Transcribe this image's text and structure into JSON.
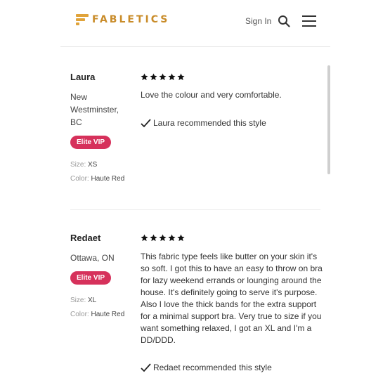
{
  "header": {
    "logo_text": "FABLETICS",
    "signin_label": "Sign In",
    "search_icon": "search-icon",
    "menu_icon": "hamburger-menu-icon"
  },
  "reviews": [
    {
      "name": "Laura",
      "location": "New Westminster, BC",
      "badge": "Elite VIP",
      "size_label": "Size:",
      "size_value": "XS",
      "color_label": "Color:",
      "color_value": "Haute Red",
      "rating": 5,
      "text": "Love the colour and very comfortable.",
      "recommend": "Laura recommended this style"
    },
    {
      "name": "Redaet",
      "location": "Ottawa, ON",
      "badge": "Elite VIP",
      "size_label": "Size:",
      "size_value": "XL",
      "color_label": "Color:",
      "color_value": "Haute Red",
      "rating": 5,
      "text": "This fabric type feels like butter on your skin it's so soft. I got this to have an easy to throw on bra for lazy weekend errands or lounging around the house. It's definitely going to serve it's purpose. Also I love the thick bands for the extra support for a minimal support bra. Very true to size if you want something relaxed, I got an XL and I'm a DD/DDD.",
      "recommend": "Redaet recommended this style"
    }
  ],
  "colors": {
    "brand": "#c98c2a",
    "badge": "#d6315b"
  }
}
